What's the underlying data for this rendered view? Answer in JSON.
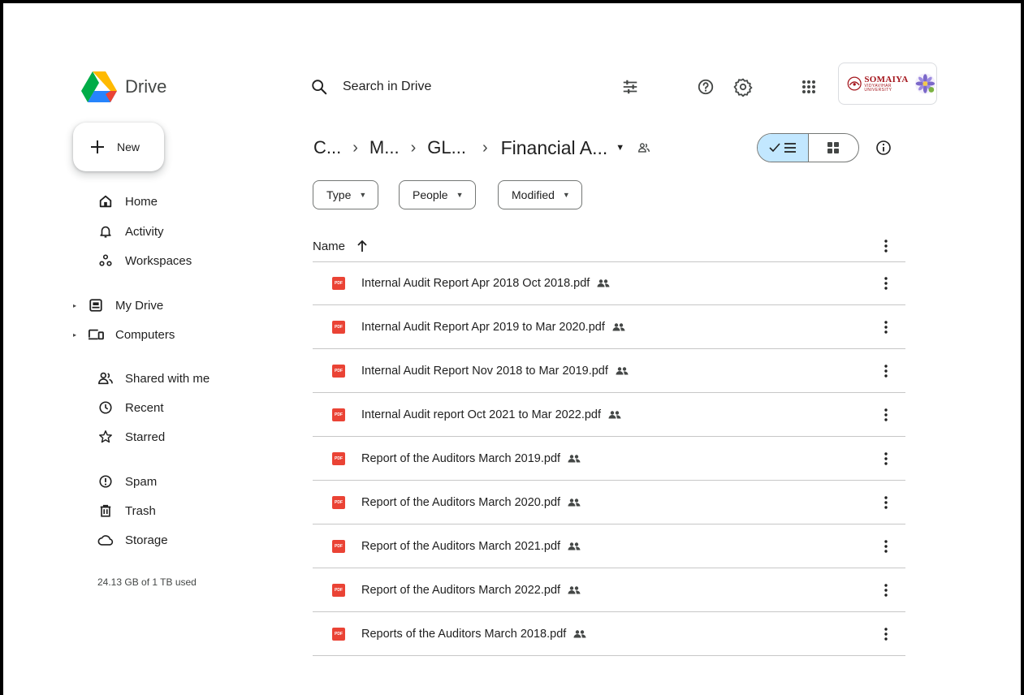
{
  "app": {
    "name": "Drive"
  },
  "search": {
    "placeholder": "Search in Drive"
  },
  "account": {
    "org_name": "SOMAIYA",
    "org_sub": "VIDYAVIHAR UNIVERSITY"
  },
  "new_button": {
    "label": "New"
  },
  "sidebar": {
    "items": [
      {
        "label": "Home",
        "icon": "home-icon"
      },
      {
        "label": "Activity",
        "icon": "bell-icon"
      },
      {
        "label": "Workspaces",
        "icon": "workspaces-icon"
      },
      {
        "label": "My Drive",
        "icon": "my-drive-icon"
      },
      {
        "label": "Computers",
        "icon": "computers-icon"
      },
      {
        "label": "Shared with me",
        "icon": "shared-icon"
      },
      {
        "label": "Recent",
        "icon": "clock-icon"
      },
      {
        "label": "Starred",
        "icon": "star-icon"
      },
      {
        "label": "Spam",
        "icon": "spam-icon"
      },
      {
        "label": "Trash",
        "icon": "trash-icon"
      },
      {
        "label": "Storage",
        "icon": "cloud-icon"
      }
    ],
    "storage_text": "24.13 GB of 1 TB used"
  },
  "breadcrumb": {
    "items": [
      "C...",
      "M...",
      "GL..."
    ],
    "current": "Financial A..."
  },
  "filters": [
    "Type",
    "People",
    "Modified"
  ],
  "list": {
    "column_name": "Name",
    "files": [
      "Internal Audit Report Apr 2018 Oct 2018.pdf",
      "Internal Audit Report Apr 2019 to Mar 2020.pdf",
      "Internal Audit Report Nov 2018 to Mar 2019.pdf",
      "Internal Audit report Oct 2021 to Mar 2022.pdf",
      "Report of the Auditors March 2019.pdf",
      "Report of the Auditors March 2020.pdf",
      "Report of the Auditors March 2021.pdf",
      "Report of the Auditors March 2022.pdf",
      "Reports of the Auditors March 2018.pdf"
    ],
    "file_icon_text": "PDF"
  },
  "colors": {
    "accent": "#c2e7ff",
    "pdf": "#ea4335",
    "text": "#1f1f1f"
  }
}
